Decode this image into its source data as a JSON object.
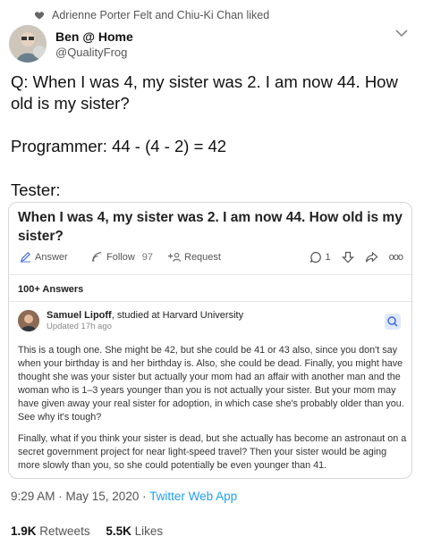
{
  "context": {
    "liked_by": "Adrienne Porter Felt and Chiu-Ki Chan liked"
  },
  "author": {
    "name": "Ben @ Home",
    "handle": "@QualityFrog"
  },
  "tweet": {
    "line1": "Q: When I was 4, my sister was 2. I am now 44. How old is my sister?",
    "line2": "Programmer: 44 - (4 - 2) = 42",
    "line3": "Tester:"
  },
  "quora": {
    "question": "When I was 4, my sister was 2. I am now 44. How old is my sister?",
    "answer_label": "Answer",
    "follow_label": "Follow",
    "follow_count": "97",
    "request_label": "Request",
    "comment_count": "1",
    "more_label": "ooo",
    "answers_count": "100+ Answers",
    "answerer_name": "Samuel Lipoff",
    "answerer_bio": ", studied at Harvard University",
    "updated": "Updated 17h ago",
    "answer_p1": "This is a tough one. She might be 42, but she could be 41 or 43 also, since you don't say when your birthday is and her birthday is. Also, she could be dead. Finally, you might have thought she was your sister but actually your mom had an affair with another man and the woman who is 1–3 years younger than you is not actually your sister. But your mom may have given away your real sister for adoption, in which case she's probably older than you. See why it's tough?",
    "answer_p2": "Finally, what if you think your sister is dead, but she actually has become an astronaut on a secret government project for near light-speed travel? Then your sister would be aging more slowly than you, so she could potentially be even younger than 41."
  },
  "meta": {
    "time_date": "9:29 AM · May 15, 2020 · ",
    "source": "Twitter Web App",
    "retweets_count": "1.9K",
    "retweets_label": "Retweets",
    "likes_count": "5.5K",
    "likes_label": "Likes"
  },
  "colors": {
    "link": "#1da1f2",
    "text": "#14171a",
    "muted": "#555555"
  },
  "icons": [
    "heart-icon",
    "chevron-down-icon",
    "pencil-icon",
    "follow-icon",
    "request-icon",
    "comment-icon",
    "downvote-icon",
    "share-icon",
    "more-icon",
    "bookmark-badge-icon"
  ]
}
